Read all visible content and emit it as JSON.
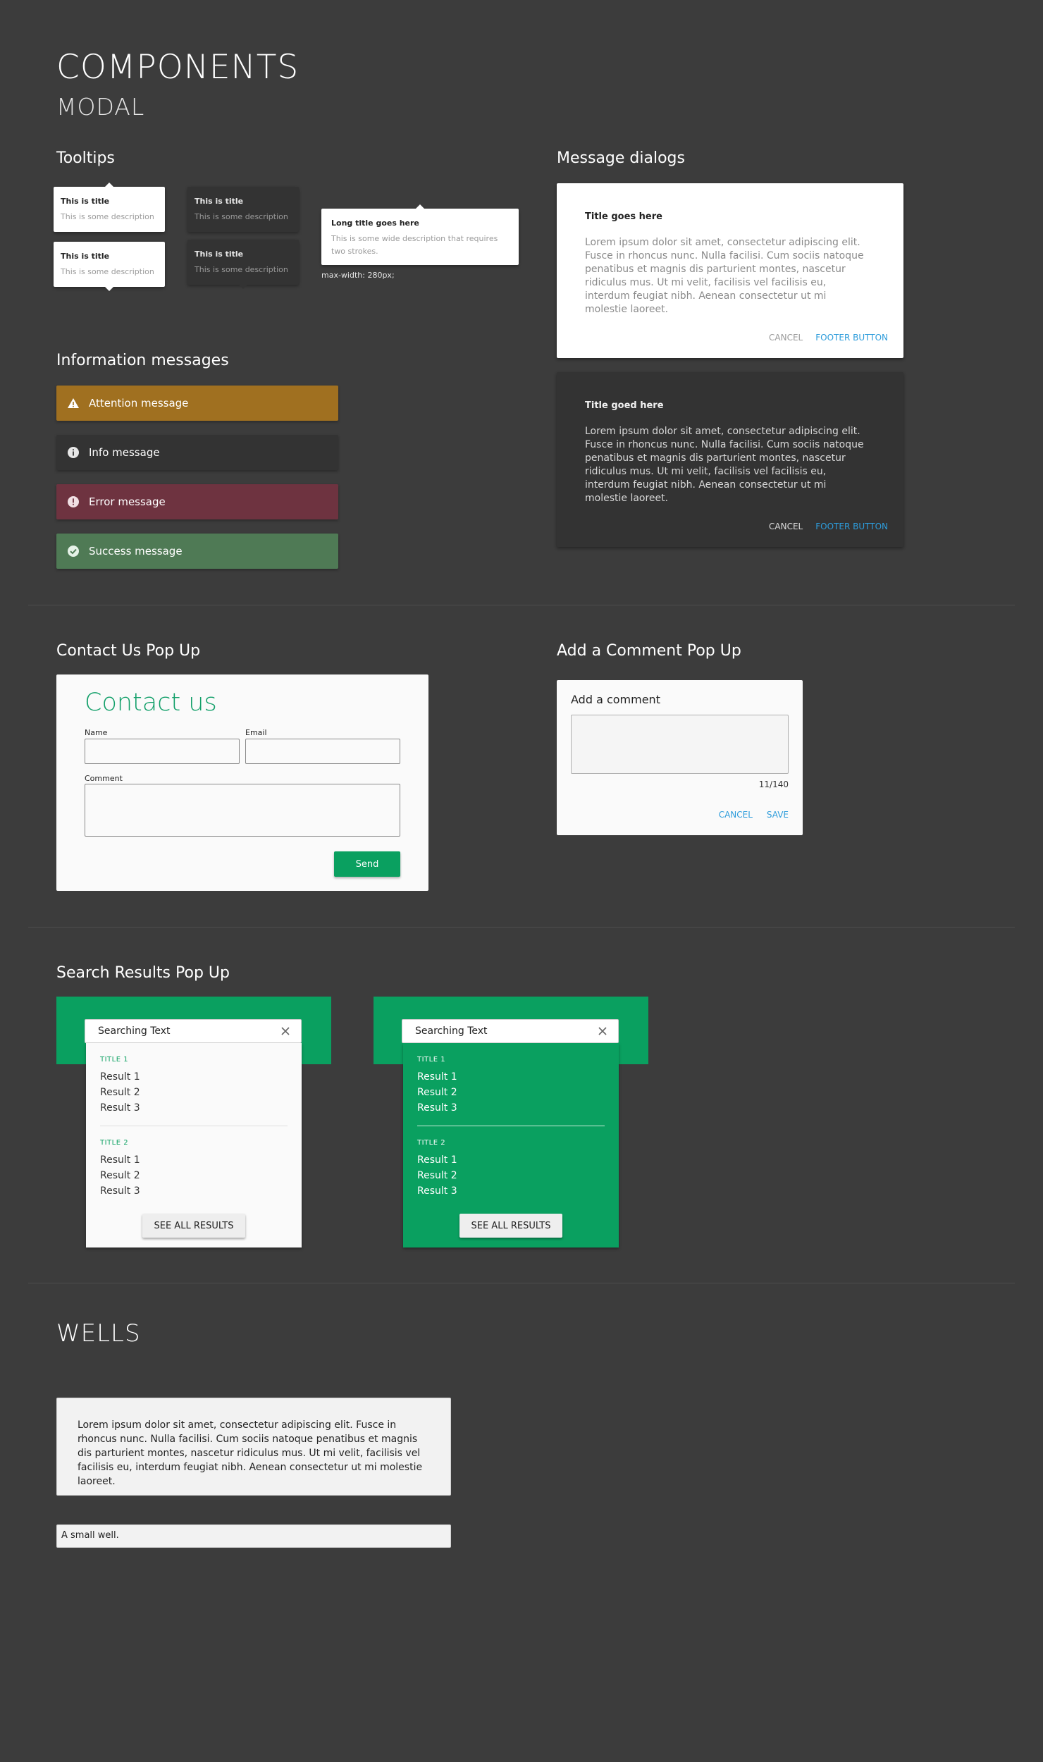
{
  "header": {
    "title": "COMPONENTS",
    "subtitle": "MODAL"
  },
  "tooltips": {
    "section_title": "Tooltips",
    "items": [
      {
        "title": "This is title",
        "description": "This is some description"
      },
      {
        "title": "This is title",
        "description": "This is some description"
      },
      {
        "title": "This is title",
        "description": "This is some description"
      },
      {
        "title": "This is title",
        "description": "This is some description"
      }
    ],
    "wide": {
      "title": "Long title goes here",
      "description": "This is some wide description that requires two strokes."
    },
    "max_width_note": "max-width: 280px;"
  },
  "info_messages": {
    "section_title": "Information messages",
    "attention": "Attention message",
    "info": "Info message",
    "error": "Error message",
    "success": "Success message",
    "colors": {
      "attention": "#a07020",
      "info": "#333333",
      "error": "#6e3340",
      "success": "#4f7a55"
    }
  },
  "dialogs": {
    "section_title": "Message dialogs",
    "light": {
      "title": "Title goes here",
      "body": "Lorem ipsum dolor sit amet, consectetur adipiscing elit. Fusce in rhoncus nunc. Nulla facilisi. Cum sociis natoque penatibus et magnis dis parturient montes, nascetur ridiculus mus. Ut mi velit, facilisis vel facilisis eu, interdum feugiat nibh. Aenean consectetur ut mi molestie laoreet.",
      "cancel": "CANCEL",
      "footer_button": "FOOTER BUTTON"
    },
    "dark": {
      "title": "Title goed here",
      "body": "Lorem ipsum dolor sit amet, consectetur adipiscing elit. Fusce in rhoncus nunc. Nulla facilisi. Cum sociis natoque penatibus et magnis dis parturient montes, nascetur ridiculus mus. Ut mi velit, facilisis vel facilisis eu, interdum feugiat nibh. Aenean consectetur ut mi molestie laoreet.",
      "cancel": "CANCEL",
      "footer_button": "FOOTER BUTTON"
    }
  },
  "contact": {
    "section_title": "Contact Us Pop Up",
    "heading": "Contact us",
    "name_label": "Name",
    "email_label": "Email",
    "comment_label": "Comment",
    "send_label": "Send",
    "accent": "#13a06a"
  },
  "comment": {
    "section_title": "Add a Comment Pop Up",
    "heading": "Add a comment",
    "counter": "11/140",
    "cancel": "CANCEL",
    "save": "SAVE"
  },
  "search": {
    "section_title": "Search Results Pop Up",
    "query": "Searching Text",
    "groups": [
      {
        "title": "TITLE 1",
        "results": [
          "Result 1",
          "Result 2",
          "Result 3"
        ]
      },
      {
        "title": "TITLE 2",
        "results": [
          "Result 1",
          "Result 2",
          "Result 3"
        ]
      }
    ],
    "see_all": "SEE ALL RESULTS"
  },
  "wells": {
    "section_title": "WELLS",
    "big_text": "Lorem ipsum dolor sit amet, consectetur adipiscing elit. Fusce in rhoncus nunc. Nulla facilisi. Cum sociis natoque penatibus et magnis dis parturient montes, nascetur ridiculus mus. Ut mi velit, facilisis vel facilisis eu, interdum feugiat nibh. Aenean consectetur ut mi molestie laoreet.",
    "small_text": "A small well."
  }
}
